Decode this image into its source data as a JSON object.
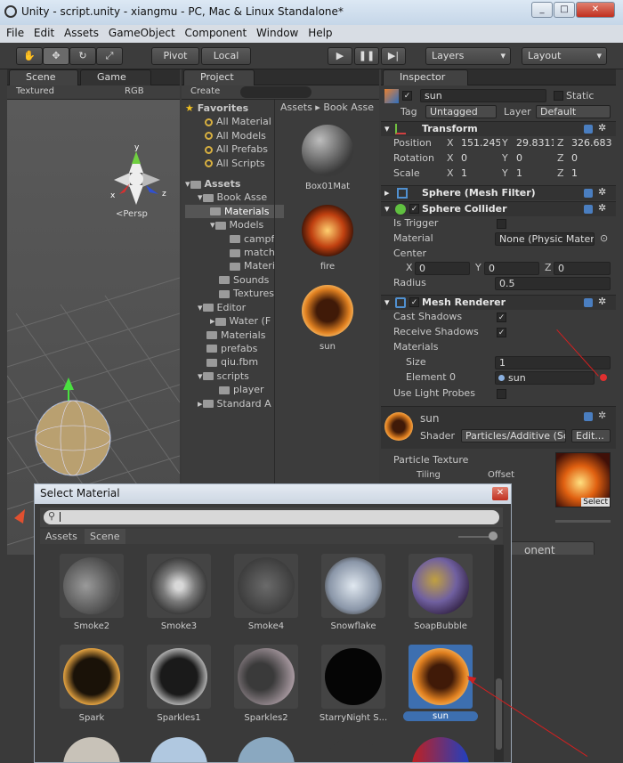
{
  "window": {
    "title": "Unity - script.unity - xiangmu - PC, Mac & Linux Standalone*"
  },
  "menu": [
    "File",
    "Edit",
    "Assets",
    "GameObject",
    "Component",
    "Window",
    "Help"
  ],
  "toolbar": {
    "pivot": "Pivot",
    "local": "Local",
    "layers": "Layers",
    "layout": "Layout"
  },
  "scene": {
    "tab_scene": "Scene",
    "tab_game": "Game",
    "render_mode": "Textured",
    "color_mode": "RGB",
    "persp": "<Persp",
    "gizmo_y": "y",
    "gizmo_x": "x",
    "gizmo_z": "z"
  },
  "project": {
    "tab": "Project",
    "create": "Create",
    "favorites": {
      "label": "Favorites",
      "items": [
        "All Material",
        "All Models",
        "All Prefabs",
        "All Scripts"
      ]
    },
    "assets_label": "Assets",
    "tree": [
      "Book Asse",
      "Materials",
      "Models",
      "campf",
      "match",
      "Materi",
      "Sounds",
      "Textures",
      "Editor",
      "Water (F",
      "Materials",
      "prefabs",
      "qiu.fbm",
      "scripts",
      "player",
      "Standard A"
    ],
    "breadcrumb": [
      "Assets",
      "Book Asse"
    ],
    "grid": [
      "Box01Mat",
      "fire",
      "sun"
    ]
  },
  "inspector": {
    "tab": "Inspector",
    "object_name": "sun",
    "static": "Static",
    "tag_label": "Tag",
    "tag": "Untagged",
    "layer_label": "Layer",
    "layer": "Default",
    "transform": {
      "title": "Transform",
      "position_label": "Position",
      "rotation_label": "Rotation",
      "scale_label": "Scale",
      "position": [
        "151.245",
        "29.8311",
        "326.683"
      ],
      "rotation": [
        "0",
        "0",
        "0"
      ],
      "scale": [
        "1",
        "1",
        "1"
      ],
      "x": "X",
      "y": "Y",
      "z": "Z"
    },
    "mesh_filter": "Sphere (Mesh Filter)",
    "sphere_collider": {
      "title": "Sphere Collider",
      "is_trigger": "Is Trigger",
      "material_label": "Material",
      "material": "None (Physic Materi",
      "center": "Center",
      "cx": "0",
      "cy": "0",
      "cz": "0",
      "radius_label": "Radius",
      "radius": "0.5"
    },
    "mesh_renderer": {
      "title": "Mesh Renderer",
      "cast_shadows": "Cast Shadows",
      "receive_shadows": "Receive Shadows",
      "materials": "Materials",
      "size_label": "Size",
      "size": "1",
      "element0_label": "Element 0",
      "element0": "sun",
      "light_probes": "Use Light Probes"
    },
    "material": {
      "name": "sun",
      "shader_label": "Shader",
      "shader": "Particles/Additive (So",
      "edit": "Edit...",
      "particle_texture": "Particle Texture",
      "tiling": "Tiling",
      "offset": "Offset",
      "select": "Select"
    },
    "add_component_fragment": "onent"
  },
  "dialog": {
    "title": "Select Material",
    "search": "",
    "tab_assets": "Assets",
    "tab_scene": "Scene",
    "items": [
      {
        "label": "Smoke2"
      },
      {
        "label": "Smoke3"
      },
      {
        "label": "Smoke4"
      },
      {
        "label": "Snowflake"
      },
      {
        "label": "SoapBubble"
      },
      {
        "label": "Spark"
      },
      {
        "label": "Sparkles1"
      },
      {
        "label": "Sparkles2"
      },
      {
        "label": "StarryNight S..."
      },
      {
        "label": "sun",
        "selected": true
      }
    ]
  },
  "colors": {
    "selection": "#3d6fb0",
    "arrow": "#d02020",
    "dark_bg": "#3a3a3a"
  }
}
